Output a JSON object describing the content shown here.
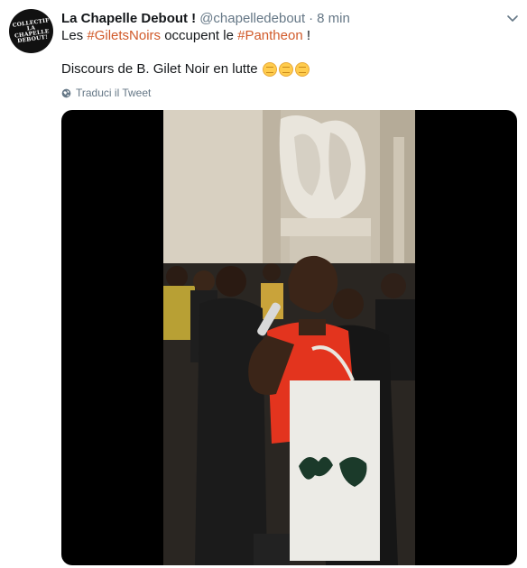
{
  "avatar": {
    "text_lines": [
      "COLLECTIF",
      "LA CHAPELLE",
      "DEBOUT!"
    ]
  },
  "header": {
    "display_name": "La Chapelle Debout !",
    "handle": "@chapelledebout",
    "separator": "·",
    "time": "8 min"
  },
  "tweet": {
    "line1_prefix": "Les ",
    "hashtag1": "#GiletsNoirs",
    "line1_middle": " occupent le ",
    "hashtag2": "#Pantheon",
    "line1_suffix": " !",
    "line2": "Discours de B. Gilet Noir en lutte",
    "emoji_icon": "raised-fist-emoji",
    "emoji_count": 3
  },
  "translate": {
    "label": "Traduci il Tweet",
    "icon": "globe-icon"
  },
  "media": {
    "type": "video"
  },
  "colors": {
    "text": "#14171a",
    "secondary": "#657786",
    "hashtag": "#d15a2a",
    "video_bg": "#000000"
  }
}
